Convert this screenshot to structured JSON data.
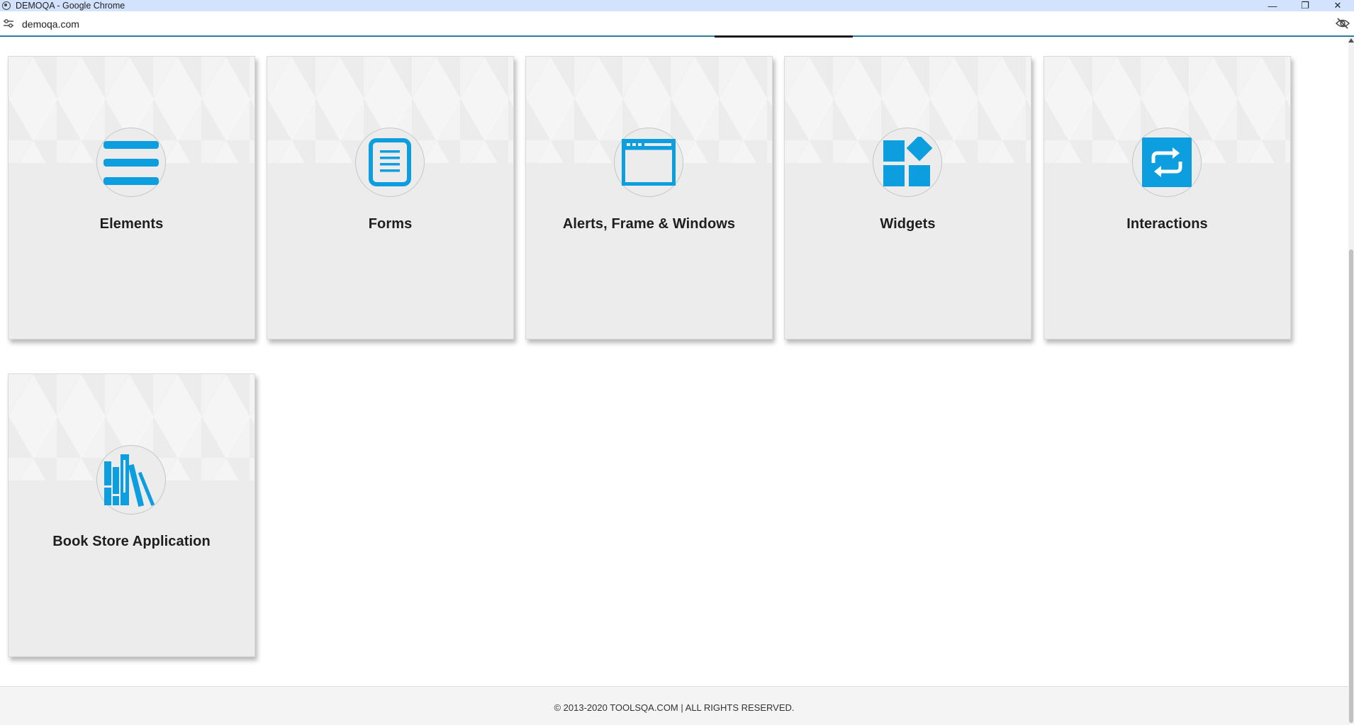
{
  "window": {
    "title": "DEMOQA - Google Chrome",
    "app_icon": "chrome-icon",
    "controls": {
      "minimize": "—",
      "restore": "❐",
      "close": "✕"
    }
  },
  "address_bar": {
    "url": "demoqa.com",
    "site_info_icon": "tune-icon",
    "visibility_icon": "eye-off-icon"
  },
  "cards": [
    {
      "title": "Elements",
      "icon": "hamburger-lines-icon"
    },
    {
      "title": "Forms",
      "icon": "document-icon"
    },
    {
      "title": "Alerts, Frame & Windows",
      "icon": "browser-window-icon"
    },
    {
      "title": "Widgets",
      "icon": "widgets-grid-icon"
    },
    {
      "title": "Interactions",
      "icon": "swap-arrows-icon"
    },
    {
      "title": "Book Store Application",
      "icon": "books-icon"
    }
  ],
  "footer": {
    "text": "© 2013-2020 TOOLSQA.COM | ALL RIGHTS RESERVED."
  },
  "colors": {
    "accent": "#0d9ee0",
    "card_bg": "#ececec",
    "titlebar_bg": "#d3e3fd"
  }
}
